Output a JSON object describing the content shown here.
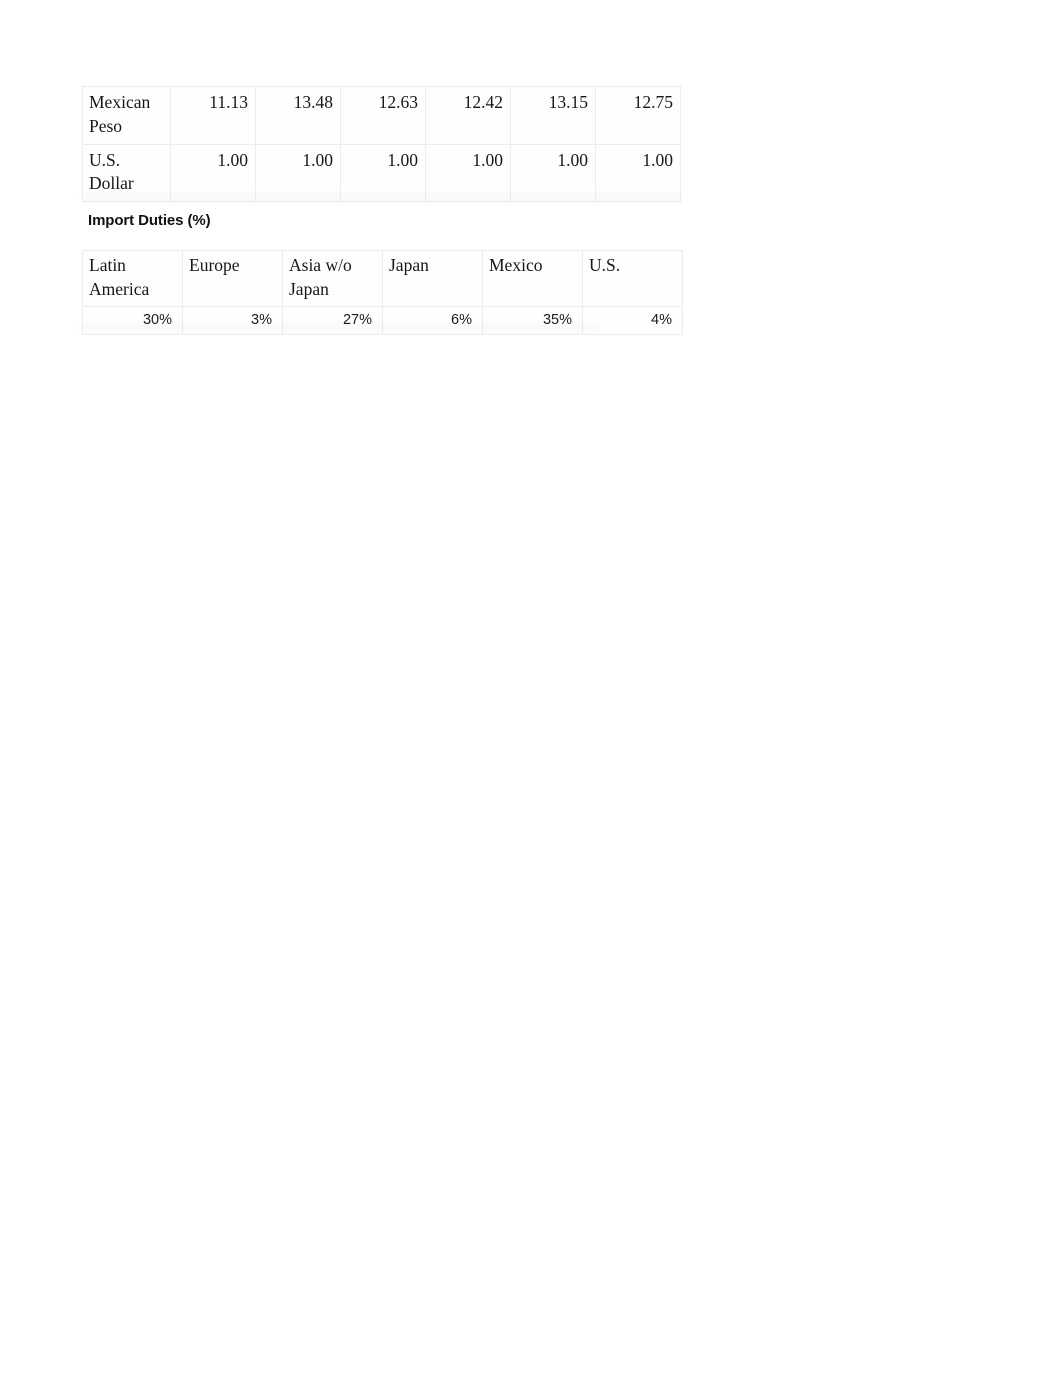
{
  "document": {
    "background_color": "#ffffff",
    "text_color": "#17171a"
  },
  "exchange_rate_table": {
    "rows": [
      {
        "label": "Mexican Peso",
        "values": [
          "11.13",
          "13.48",
          "12.63",
          "12.42",
          "13.15",
          "12.75"
        ]
      },
      {
        "label": "U.S. Dollar",
        "values": [
          "1.00",
          "1.00",
          "1.00",
          "1.00",
          "1.00",
          "1.00"
        ]
      }
    ]
  },
  "import_duties": {
    "heading": "Import Duties (%)",
    "headers": [
      "Latin America",
      "Europe",
      "Asia w/o Japan",
      "Japan",
      "Mexico",
      "U.S."
    ],
    "values": [
      "30%",
      "3%",
      "27%",
      "6%",
      "35%",
      "4%"
    ]
  }
}
